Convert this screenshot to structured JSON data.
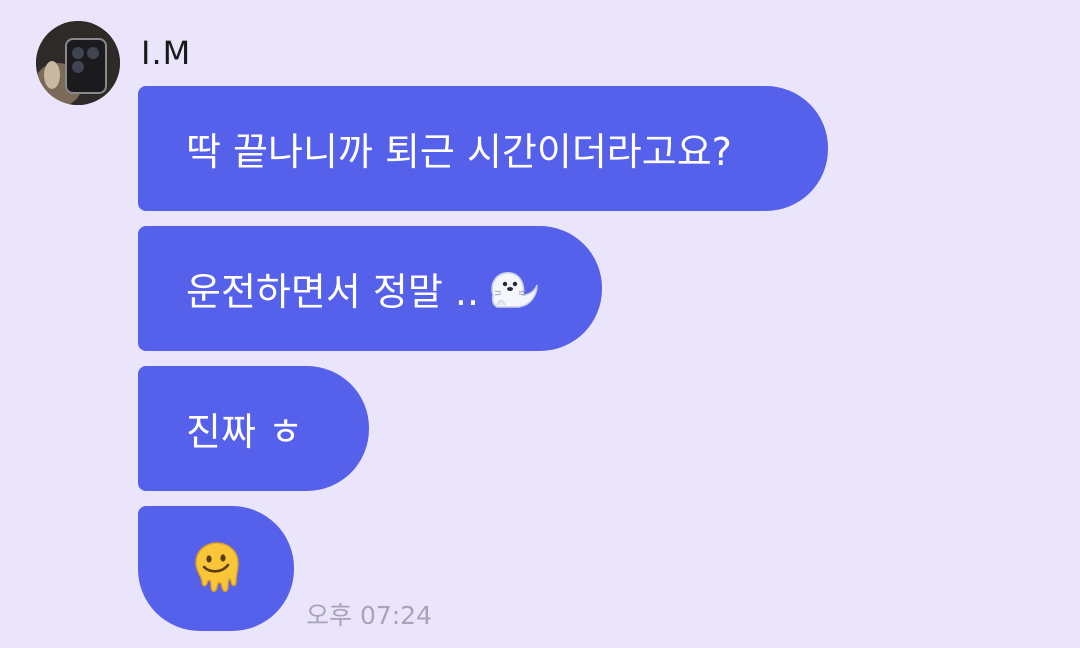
{
  "sender": {
    "name": "I.M",
    "avatar": "profile-photo"
  },
  "messages": [
    {
      "text": "딱 끝나니까 퇴근 시간이더라고요?"
    },
    {
      "text": "운전하면서 정말 ..",
      "emoji": "seal-emoji"
    },
    {
      "text": "진짜 ㅎ"
    },
    {
      "text": "",
      "emoji": "melting-face-emoji"
    }
  ],
  "timestamp": "오후 07:24",
  "colors": {
    "background": "#ebe5fb",
    "bubble": "#5560eb",
    "bubble_text": "#ffffff",
    "timestamp": "#a8a3b6"
  }
}
